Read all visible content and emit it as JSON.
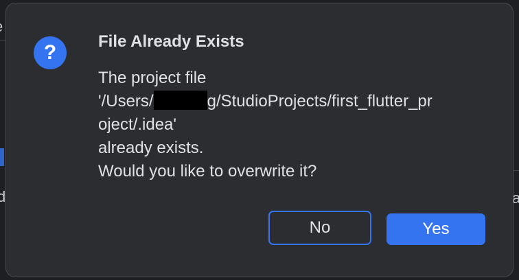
{
  "background": {
    "fragments": [
      "e",
      "‹",
      "d",
      "a"
    ]
  },
  "dialog": {
    "icon": "question-icon",
    "title": "File Already Exists",
    "message": {
      "line1": "The project file",
      "line2_prefix": "'/Users/",
      "line2_suffix": "g/StudioProjects/first_flutter_pr",
      "line3": "oject/.idea'",
      "line4": "already exists.",
      "line5": "Would you like to overwrite it?"
    },
    "buttons": {
      "no_label": "No",
      "yes_label": "Yes"
    }
  },
  "colors": {
    "accent": "#3574f0",
    "dialog_bg": "#2b2d30",
    "text": "#dfe1e5"
  }
}
